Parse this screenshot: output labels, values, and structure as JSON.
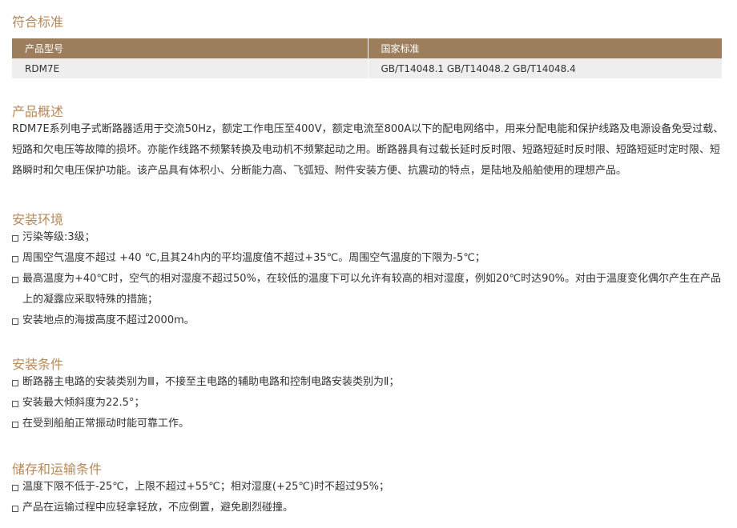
{
  "sections": {
    "standards": {
      "title": "符合标准",
      "headers": [
        "产品型号",
        "国家标准"
      ],
      "row": [
        "RDM7E",
        "GB/T14048.1  GB/T14048.2  GB/T14048.4"
      ]
    },
    "overview": {
      "title": "产品概述",
      "text": "RDM7E系列电子式断路器适用于交流50Hz，额定工作电压至400V，额定电流至800A以下的配电网络中，用来分配电能和保护线路及电源设备免受过载、短路和欠电压等故障的损坏。亦能作线路不频繁转换及电动机不频繁起动之用。断路器具有过载长延时反时限、短路短延时反时限、短路短延时定时限、短路瞬时和欠电压保护功能。该产品具有体积小、分断能力高、飞弧短、附件安装方便、抗震动的特点，是陆地及船舶使用的理想产品。"
    },
    "environment": {
      "title": "安装环境",
      "items": [
        "污染等级:3级；",
        "周围空气温度不超过 +40 ℃,且其24h内的平均温度值不超过+35℃。周围空气温度的下限为-5℃；",
        "最高温度为+40℃时，空气的相对湿度不超过50%，在较低的温度下可以允许有较高的相对湿度，例如20℃时达90%。对由于温度变化偶尔产生在产品上的凝露应采取特殊的措施；",
        "安装地点的海拔高度不超过2000m。"
      ]
    },
    "conditions": {
      "title": "安装条件",
      "items": [
        "断路器主电路的安装类别为Ⅲ，不接至主电路的辅助电路和控制电路安装类别为Ⅱ；",
        "安装最大倾斜度为22.5°；",
        "在受到船舶正常振动时能可靠工作。"
      ]
    },
    "storage": {
      "title": "储存和运输条件",
      "items": [
        "温度下限不低于-25℃，上限不超过+55℃；相对湿度(+25℃)时不超过95%；",
        "产品在运输过程中应轻拿轻放，不应倒置，避免剧烈碰撞。"
      ]
    }
  },
  "colors": {
    "heading": "#b8895a",
    "table_header_bg": "#9c7d5c",
    "table_row_bg": "#eeeeee",
    "text": "#333333"
  }
}
